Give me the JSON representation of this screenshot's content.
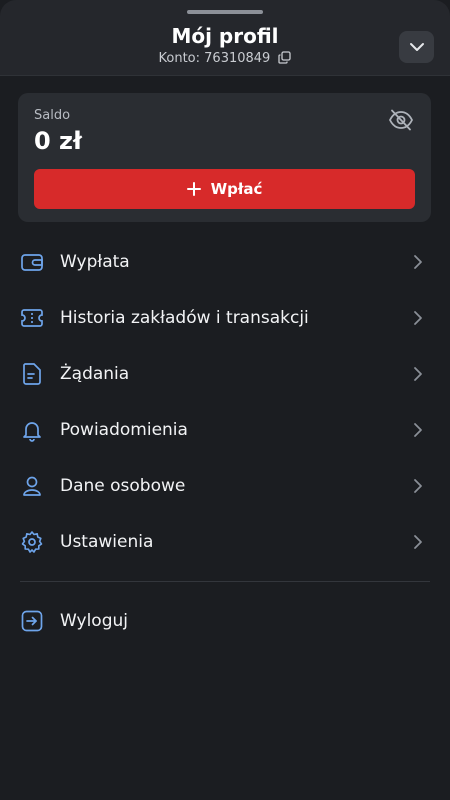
{
  "header": {
    "title": "Mój profil",
    "account_label": "Konto: 76310849"
  },
  "balance": {
    "label": "Saldo",
    "value": "0 zł",
    "deposit_label": "Wpłać"
  },
  "menu": {
    "items": [
      {
        "label": "Wypłata",
        "icon": "wallet-icon"
      },
      {
        "label": "Historia zakładów i transakcji",
        "icon": "ticket-icon"
      },
      {
        "label": "Żądania",
        "icon": "document-icon"
      },
      {
        "label": "Powiadomienia",
        "icon": "bell-icon"
      },
      {
        "label": "Dane osobowe",
        "icon": "user-icon"
      },
      {
        "label": "Ustawienia",
        "icon": "gear-icon"
      }
    ],
    "logout_label": "Wyloguj"
  },
  "colors": {
    "background": "#1b1d21",
    "header": "#25272c",
    "card": "#2a2d32",
    "accent_red": "#d72a2a",
    "icon_blue": "#6ea4ea"
  }
}
